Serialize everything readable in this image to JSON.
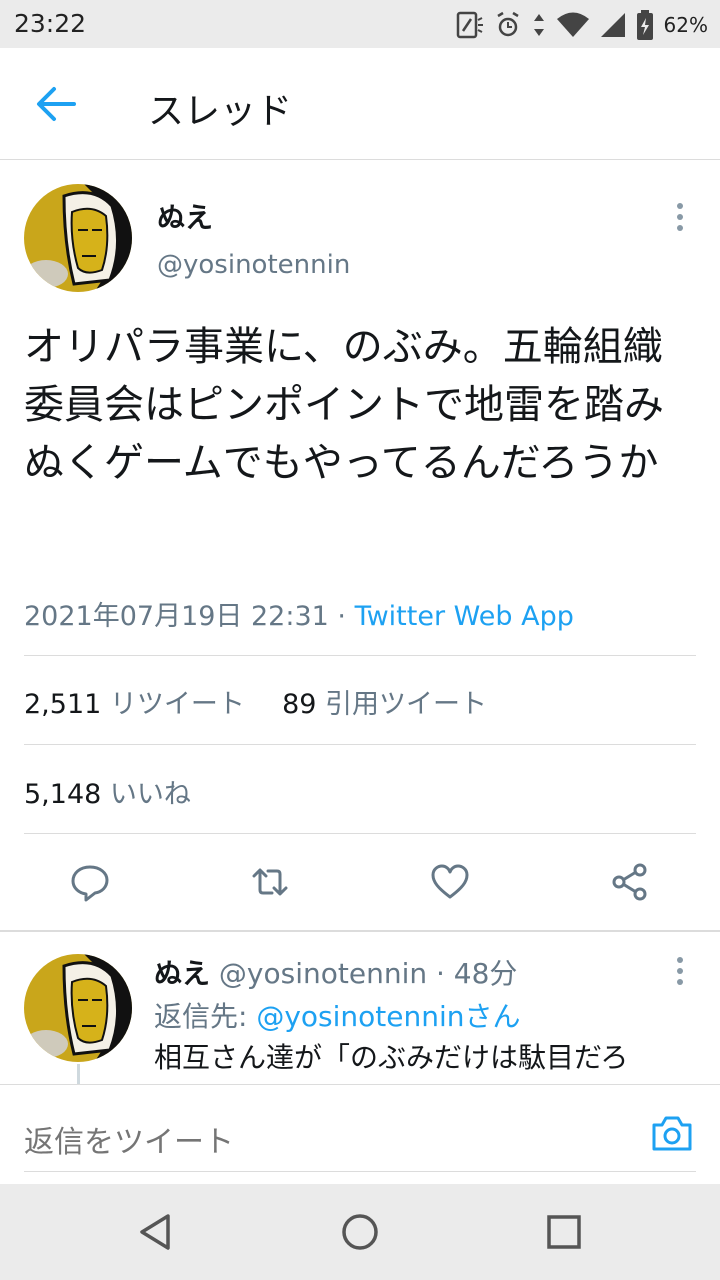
{
  "status_bar": {
    "time": "23:22",
    "battery_percent": "62%",
    "icons": [
      "nfc-icon",
      "alarm-icon",
      "data-arrows-icon",
      "wifi-icon",
      "signal-icon",
      "battery-icon"
    ]
  },
  "header": {
    "back_icon": "arrow-left-icon",
    "title": "スレッド"
  },
  "tweet": {
    "name": "ぬえ",
    "handle": "@yosinotennin",
    "text": "オリパラ事業に、のぶみ。五輪組織委員会はピンポイントで地雷を踏みぬくゲームでもやってるんだろうか",
    "date": "2021年07月19日 22:31",
    "separator": " · ",
    "source": "Twitter Web App",
    "retweets_count": "2,511",
    "retweets_label": "リツイート",
    "quotes_count": "89",
    "quotes_label": "引用ツイート",
    "likes_count": "5,148",
    "likes_label": "いいね"
  },
  "actions": [
    "reply-icon",
    "retweet-icon",
    "like-icon",
    "share-icon"
  ],
  "reply": {
    "name": "ぬえ",
    "handle": "@yosinotennin",
    "time": " · 48分",
    "reply_to_label": "返信先: ",
    "reply_to_handle": "@yosinotenninさん",
    "text": "相互さん達が「のぶみだけは駄目だろ"
  },
  "compose": {
    "placeholder": "返信をツイート"
  },
  "colors": {
    "accent": "#1da1f2",
    "secondary_text": "#657786",
    "avatar_bg": "#c9a61b"
  }
}
